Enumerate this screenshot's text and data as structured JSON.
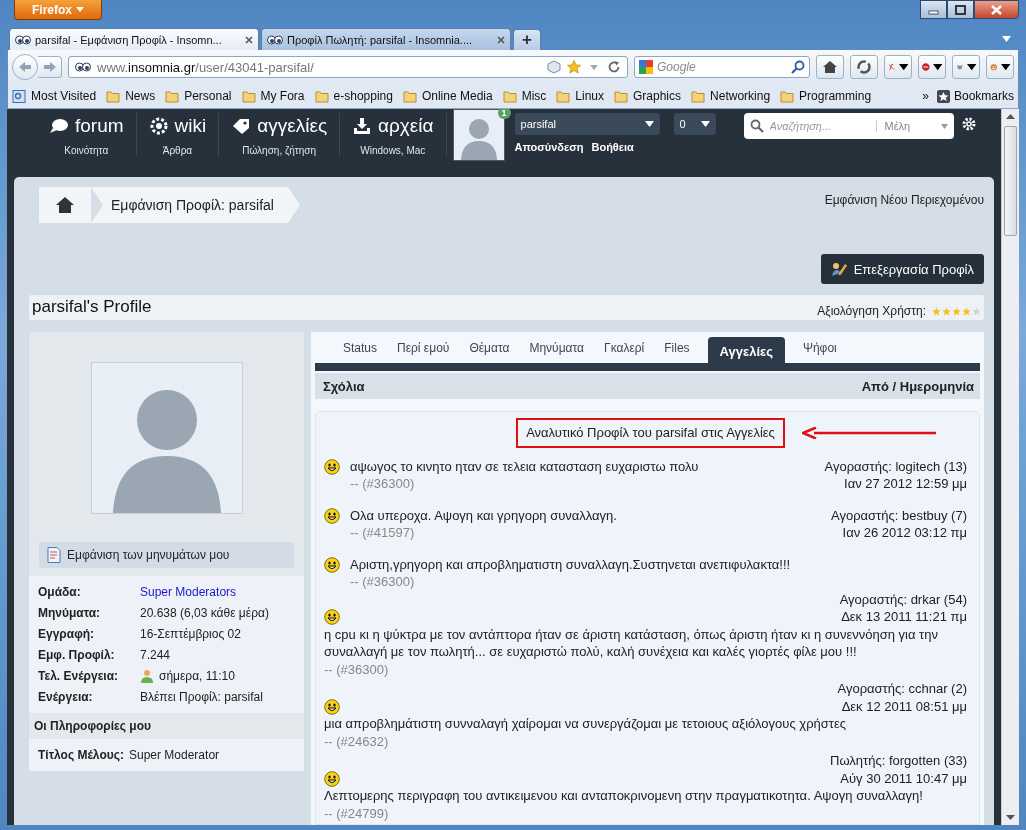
{
  "browser": {
    "menu_button": "Firefox",
    "tabs": [
      {
        "title": "parsifal - Εμφάνιση Προφίλ - Insomn...",
        "selected": true
      },
      {
        "title": "Προφίλ Πωλητή: parsifal - Insomnia....",
        "selected": false
      }
    ],
    "new_tab": "+",
    "url": {
      "prefix": "www.",
      "host": "insomnia.gr",
      "path": "/user/43041-parsifal/"
    },
    "search_placeholder": "Google",
    "bookmarks": [
      "Most Visited",
      "News",
      "Personal",
      "My Fora",
      "e-shopping",
      "Online Media",
      "Misc",
      "Linux",
      "Graphics",
      "Networking",
      "Programming"
    ],
    "bookmarks_overflow": "»",
    "bookmarks_menu": "Bookmarks"
  },
  "site_nav": [
    {
      "label": "forum",
      "sub": "Κοινότητα"
    },
    {
      "label": "wiki",
      "sub": "Άρθρα"
    },
    {
      "label": "αγγελίες",
      "sub": "Πώληση, ζήτηση"
    },
    {
      "label": "αρχεία",
      "sub": "Windows, Mac"
    }
  ],
  "user_panel": {
    "notification_count": "1",
    "username": "parsifal",
    "counter": "0",
    "links": [
      "Αποσύνδεση",
      "Βοήθεια"
    ]
  },
  "site_search": {
    "placeholder": "Αναζήτηση...",
    "scope": "Μέλη"
  },
  "breadcrumb": "Εμφάνιση Προφίλ: parsifal",
  "new_content_link": "Εμφάνιση Νέου Περιεχομένου",
  "edit_button": "Επεξεργασία Προφίλ",
  "profile": {
    "title": "parsifal's Profile",
    "rating_label": "Αξιολόγηση Χρήστη:",
    "stars": 4
  },
  "sidebar": {
    "posts_link": "Εμφάνιση των μηνυμάτων μου",
    "fields": [
      {
        "label": "Ομάδα:",
        "value": "Super Moderators",
        "kind": "link"
      },
      {
        "label": "Μηνύματα:",
        "value": "20.638 (6,03 κάθε μέρα)",
        "kind": "text"
      },
      {
        "label": "Εγγραφή:",
        "value": "16-Σεπτέμβριος 02",
        "kind": "text"
      },
      {
        "label": "Εμφ. Προφίλ:",
        "value": "7.244",
        "kind": "text"
      },
      {
        "label": "Τελ. Ενέργεια:",
        "value": "σήμερα, 11:10",
        "kind": "online"
      },
      {
        "label": "Ενέργεια:",
        "value": "Βλέπει Προφίλ: parsifal",
        "kind": "text"
      }
    ],
    "info_heading": "Οι Πληροφορίες μου",
    "info_fields": [
      {
        "label": "Τίτλος Μέλους:",
        "value": "Super Moderator"
      }
    ]
  },
  "content_tabs": [
    {
      "label": "Status",
      "selected": false
    },
    {
      "label": "Περί εμού",
      "selected": false
    },
    {
      "label": "Θέματα",
      "selected": false
    },
    {
      "label": "Μηνύματα",
      "selected": false
    },
    {
      "label": "Γκαλερί",
      "selected": false
    },
    {
      "label": "Files",
      "selected": false
    },
    {
      "label": "Αγγελίες",
      "selected": true
    },
    {
      "label": "Ψήφοι",
      "selected": false
    }
  ],
  "feedback": {
    "column_1": "Σχόλια",
    "column_2": "Από / Ημερομηνία",
    "profile_link": "Αναλυτικό Προφίλ του parsifal στις Αγγελίες",
    "entries": [
      {
        "kind": "inline",
        "comment": "αψωγος το κινητο ηταν σε τελεια κατασταση ευχαριστω πολυ",
        "ref": "-- (#36300)",
        "party": "Αγοραστής: logitech (13)",
        "date": "Ιαν 27 2012 12:59 μμ"
      },
      {
        "kind": "inline",
        "comment": "Ολα υπεροχα. Αψογη και γρηγορη συναλλαγη.",
        "ref": "-- (#41597)",
        "party": "Αγοραστής: bestbuy (7)",
        "date": "Ιαν 26 2012 03:12 πμ"
      },
      {
        "kind": "inline",
        "comment": "Αριστη,γρηγορη και απροβληματιστη συναλλαγη.Συστηνεται ανεπιφυλακτα!!!",
        "ref": "-- (#36300)"
      },
      {
        "kind": "stacked",
        "comment": "η cpu κι η ψύκτρα με τον αντάπτορα ήταν σε άριστη κατάσταση, όπως άριστη ήταν κι η συνεννόηση για την συναλλαγή με τον πωλητή... σε ευχαριστώ πολύ, καλή συνέχεια και καλές γιορτές φίλε μου !!!",
        "ref": "-- (#36300)",
        "party": "Αγοραστής: drkar (54)",
        "date": "Δεκ 13 2011 11:21 πμ"
      },
      {
        "kind": "stacked",
        "comment": "μια απροβλημάτιστη συνναλαγή χαίρομαι να συνεργάζομαι με τετοιους αξιόλογους χρήστες",
        "ref": "-- (#24632)",
        "party": "Αγοραστής: cchnar (2)",
        "date": "Δεκ 12 2011 08:51 μμ"
      },
      {
        "kind": "stacked",
        "comment": "Λεπτομερης περιγραφη του αντικειμενου και ανταποκρινομενη στην πραγματικοτητα. Αψογη συναλλαγη!",
        "ref": "-- (#24799)",
        "party": "Πωλητής: forgotten (33)",
        "date": "Αύγ 30 2011 10:47 μμ"
      }
    ]
  }
}
